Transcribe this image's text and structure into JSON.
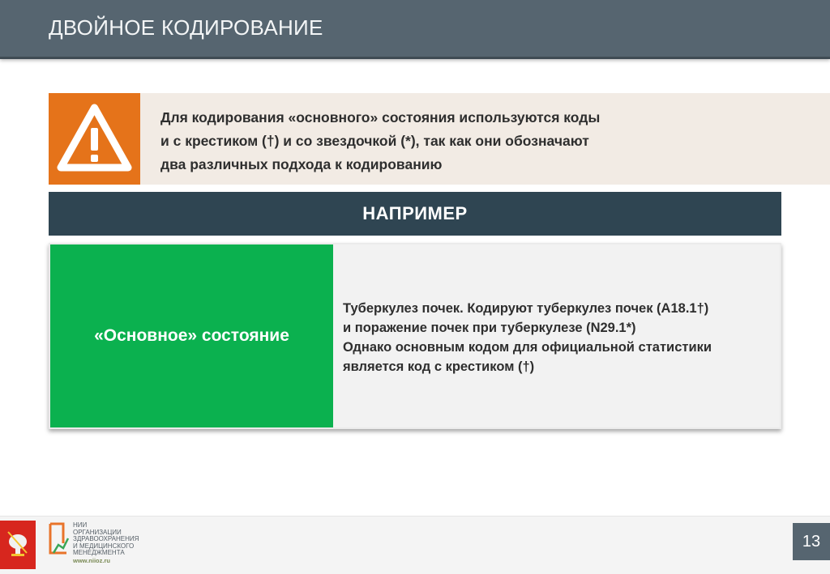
{
  "header": {
    "title": "ДВОЙНОЕ КОДИРОВАНИЕ"
  },
  "warning": {
    "icon": "warning-triangle-icon",
    "lines": [
      "Для кодирования «основного» состояния используются коды",
      "и с крестиком (†) и со звездочкой (*), так как они обозначают",
      "два различных подхода к кодированию"
    ]
  },
  "example": {
    "label": "НАПРИМЕР",
    "left_label": "«Основное» состояние",
    "right_lines": [
      "Туберкулез почек. Кодируют туберкулез почек (A18.1†)",
      "и поражение почек при туберкулезе (N29.1*)",
      "Однако основным кодом для официальной статистики",
      "является код с крестиком (†)"
    ]
  },
  "footer": {
    "logo_lines": [
      "НИИ",
      "ОРГАНИЗАЦИИ",
      "ЗДРАВООХРАНЕНИЯ",
      "И МЕДИЦИНСКОГО",
      "МЕНЕДЖМЕНТА"
    ],
    "url": "www.niioz.ru",
    "emblem": "moscow-coat-of-arms-icon",
    "page_number": "13"
  },
  "colors": {
    "header_bg": "#566570",
    "warning_orange": "#e5731a",
    "warning_bg": "#f2ebe4",
    "example_bar": "#2f4552",
    "primary_green": "#0bb14f",
    "moscow_red": "#d7261e"
  }
}
